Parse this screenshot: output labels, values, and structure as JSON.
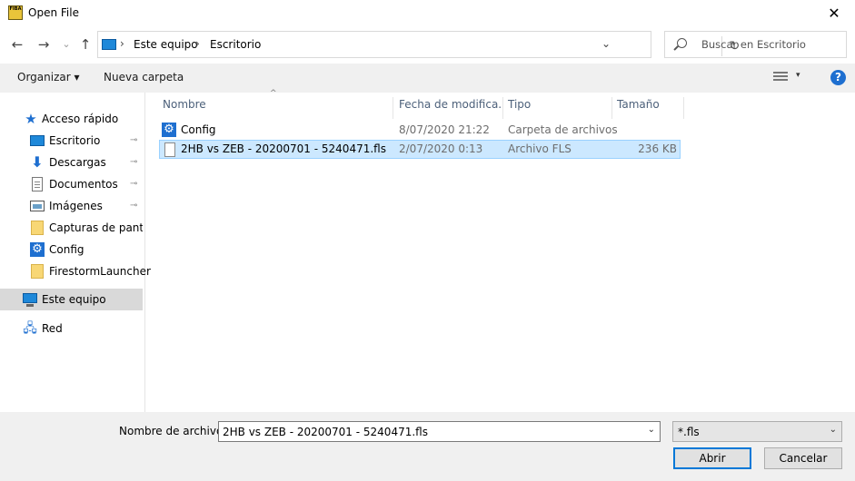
{
  "window": {
    "app_icon_text": "FIBA",
    "title": "Open File",
    "close_glyph": "✕"
  },
  "nav": {
    "back_glyph": "←",
    "forward_glyph": "→",
    "recent_glyph": "⌄",
    "up_glyph": "↑",
    "breadcrumb": [
      "Este equipo",
      "Escritorio"
    ],
    "separator": "›",
    "dropdown_glyph": "⌄",
    "refresh_glyph": "↻",
    "search_placeholder": "Buscar en Escritorio"
  },
  "toolbar": {
    "organize_label": "Organizar ▾",
    "new_folder_label": "Nueva carpeta",
    "view_drop_glyph": "▾",
    "help_glyph": "?"
  },
  "navpane": {
    "items": [
      {
        "label": "Acceso rápido",
        "icon": "star-icon",
        "pinned": false
      },
      {
        "label": "Escritorio",
        "icon": "desktop-icon",
        "pinned": true
      },
      {
        "label": "Descargas",
        "icon": "download-icon",
        "pinned": true
      },
      {
        "label": "Documentos",
        "icon": "documents-icon",
        "pinned": true
      },
      {
        "label": "Imágenes",
        "icon": "pictures-icon",
        "pinned": true
      },
      {
        "label": "Capturas de pantall",
        "icon": "folder-icon",
        "pinned": false
      },
      {
        "label": "Config",
        "icon": "gear-folder-icon",
        "pinned": false
      },
      {
        "label": "FirestormLauncher",
        "icon": "folder-icon",
        "pinned": false
      },
      {
        "label": "Este equipo",
        "icon": "computer-icon",
        "pinned": false,
        "selected": true
      },
      {
        "label": "Red",
        "icon": "network-icon",
        "pinned": false
      }
    ],
    "pin_glyph": "📌"
  },
  "filelist": {
    "sort_glyph": "^",
    "columns": [
      "Nombre",
      "Fecha de modifica...",
      "Tipo",
      "Tamaño"
    ],
    "rows": [
      {
        "name": "Config",
        "date": "8/07/2020 21:22",
        "type": "Carpeta de archivos",
        "size": "",
        "icon": "gear-folder-icon",
        "selected": false
      },
      {
        "name": "2HB vs ZEB - 20200701 - 5240471.fls",
        "date": "2/07/2020 0:13",
        "type": "Archivo FLS",
        "size": "236 KB",
        "icon": "file-icon",
        "selected": true
      }
    ]
  },
  "footer": {
    "filename_label": "Nombre de archivo:",
    "filename_value": "2HB vs ZEB - 20200701 - 5240471.fls",
    "filetype_value": "*.fls",
    "dropdown_glyph": "⌄",
    "open_label": "Abrir",
    "cancel_label": "Cancelar"
  },
  "colors": {
    "accent": "#0078d7",
    "selection_bg": "#cce8ff",
    "selection_border": "#99d1ff",
    "header_text": "#4c607a"
  }
}
